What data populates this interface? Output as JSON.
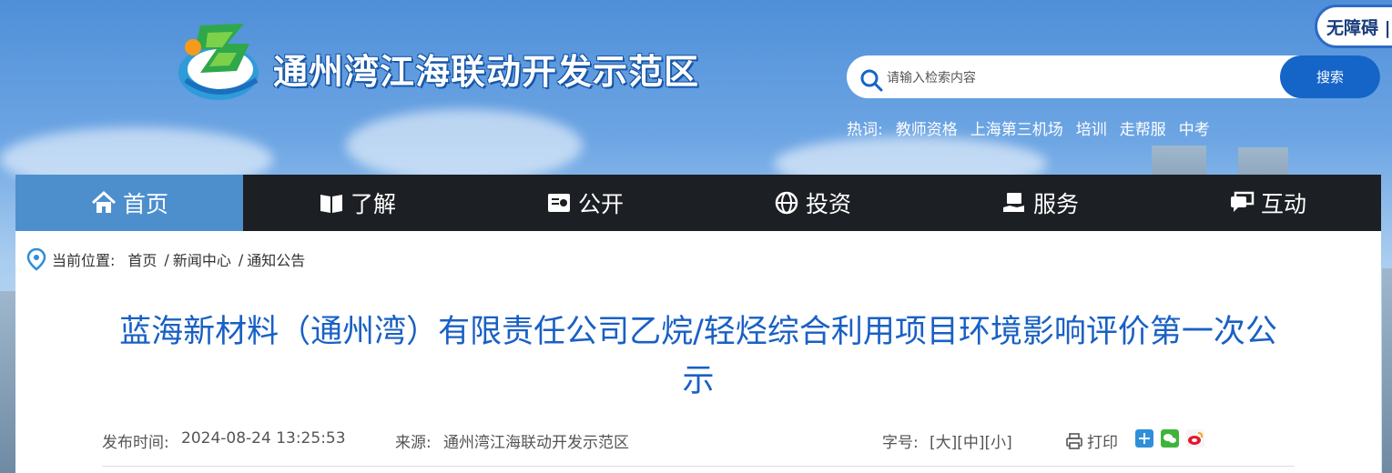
{
  "header": {
    "site_title": "通州湾江海联动开发示范区",
    "accessibility_label": "无障碍 |",
    "search": {
      "placeholder": "请输入检索内容",
      "button_label": "搜索"
    },
    "hot": {
      "label": "热词:",
      "words": [
        "教师资格",
        "上海第三机场",
        "培训",
        "走帮服",
        "中考"
      ]
    }
  },
  "nav": {
    "items": [
      {
        "label": "首页",
        "icon": "home-icon"
      },
      {
        "label": "了解",
        "icon": "book-icon"
      },
      {
        "label": "公开",
        "icon": "info-card-icon"
      },
      {
        "label": "投资",
        "icon": "globe-icon"
      },
      {
        "label": "服务",
        "icon": "service-icon"
      },
      {
        "label": "互动",
        "icon": "chat-icon"
      }
    ],
    "active_index": 0
  },
  "breadcrumb": {
    "label": "当前位置:",
    "items": [
      "首页",
      "新闻中心",
      "通知公告"
    ],
    "separator": "/"
  },
  "article": {
    "title": "蓝海新材料（通州湾）有限责任公司乙烷/轻烃综合利用项目环境影响评价第一次公示",
    "publish_label": "发布时间:",
    "publish_time": "2024-08-24 13:25:53",
    "source_label": "来源:",
    "source": "通州湾江海联动开发示范区",
    "font_label": "字号:",
    "font_sizes": [
      "[大]",
      "[中]",
      "[小]"
    ],
    "print_label": "打印",
    "share_icons": [
      "share-plus-icon",
      "wechat-icon",
      "weibo-icon"
    ]
  },
  "colors": {
    "nav_background": "#1c1f23",
    "nav_active": "#4d8fcd",
    "title_blue": "#1960c4",
    "search_button": "#1565c8"
  }
}
